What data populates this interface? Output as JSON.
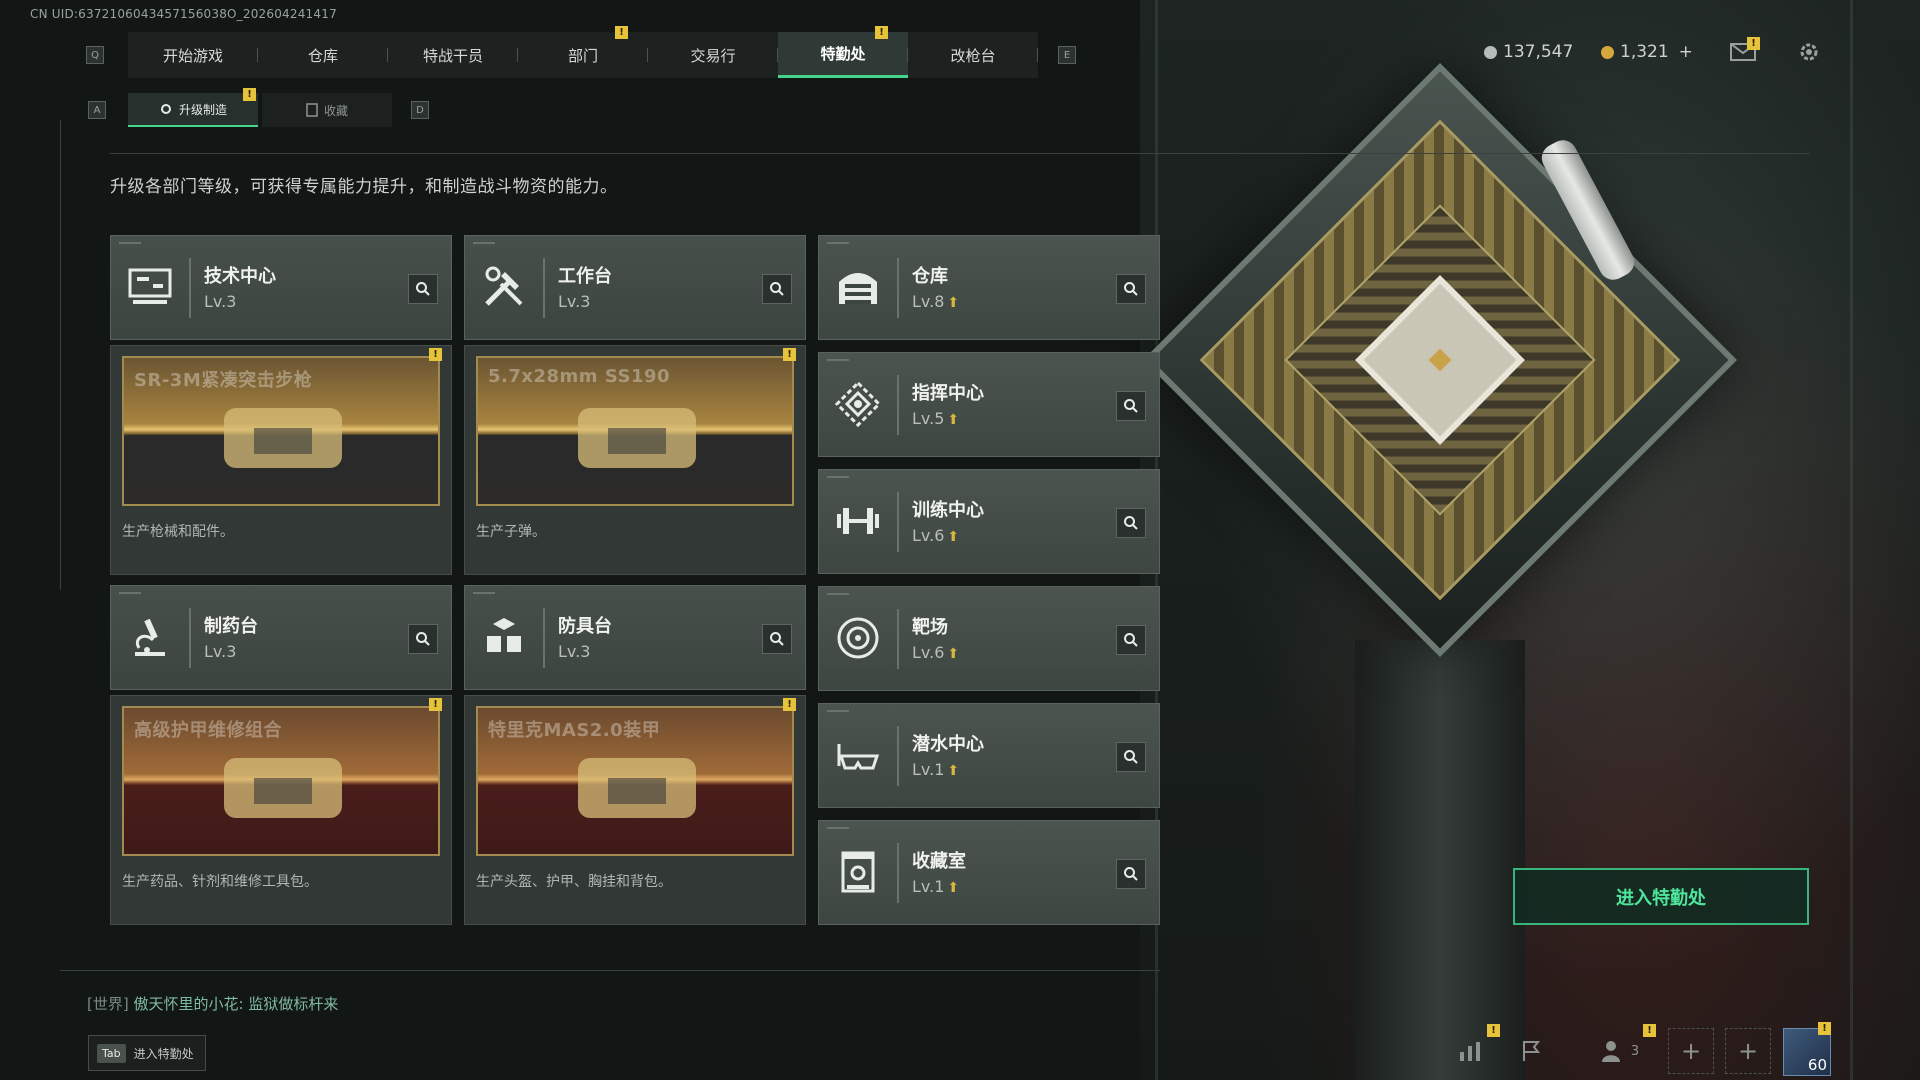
{
  "uid": "CN UID:6372106043457156038O_202604241417",
  "key_hints": {
    "left": "Q",
    "right": "E",
    "sub_left": "A",
    "sub_right": "D"
  },
  "nav": {
    "tabs": [
      {
        "label": "开始游戏",
        "active": false,
        "badge": false
      },
      {
        "label": "仓库",
        "active": false,
        "badge": false
      },
      {
        "label": "特战干员",
        "active": false,
        "badge": false
      },
      {
        "label": "部门",
        "active": false,
        "badge": true
      },
      {
        "label": "交易行",
        "active": false,
        "badge": false
      },
      {
        "label": "特勤处",
        "active": true,
        "badge": true
      },
      {
        "label": "改枪台",
        "active": false,
        "badge": false
      }
    ]
  },
  "currency": {
    "silver": {
      "value": "137,547",
      "color": "#b8bcb8"
    },
    "gold": {
      "value": "1,321",
      "color": "#d6a83c"
    },
    "add_symbol": "+"
  },
  "badge_symbol": "!",
  "subtabs": [
    {
      "label": "升级制造",
      "active": true,
      "badge": true
    },
    {
      "label": "收藏",
      "active": false,
      "badge": false
    }
  ],
  "description": "升级各部门等级，可获得专属能力提升，和制造战斗物资的能力。",
  "workshops": [
    {
      "name": "技术中心",
      "level": "Lv.3",
      "icon": "computer-icon",
      "upgradable": false,
      "product": {
        "name": "SR-3M紧凑突击步枪",
        "desc": "生产枪械和配件。",
        "theme": "gold",
        "badge": true
      }
    },
    {
      "name": "工作台",
      "level": "Lv.3",
      "icon": "tools-icon",
      "upgradable": false,
      "product": {
        "name": "5.7x28mm SS190",
        "desc": "生产子弹。",
        "theme": "gold",
        "badge": true
      }
    },
    {
      "name": "制药台",
      "level": "Lv.3",
      "icon": "microscope-icon",
      "upgradable": false,
      "product": {
        "name": "高级护甲维修组合",
        "desc": "生产药品、针剂和维修工具包。",
        "theme": "red",
        "badge": true
      }
    },
    {
      "name": "防具台",
      "level": "Lv.3",
      "icon": "armor-boxes-icon",
      "upgradable": false,
      "product": {
        "name": "特里克MAS2.0装甲",
        "desc": "生产头盔、护甲、胸挂和背包。",
        "theme": "red",
        "badge": true
      }
    }
  ],
  "departments": [
    {
      "name": "仓库",
      "level": "Lv.8",
      "icon": "warehouse-icon",
      "upgradable": true
    },
    {
      "name": "指挥中心",
      "level": "Lv.5",
      "icon": "command-icon",
      "upgradable": true
    },
    {
      "name": "训练中心",
      "level": "Lv.6",
      "icon": "dumbbell-icon",
      "upgradable": true
    },
    {
      "name": "靶场",
      "level": "Lv.6",
      "icon": "target-icon",
      "upgradable": true
    },
    {
      "name": "潜水中心",
      "level": "Lv.1",
      "icon": "goggles-icon",
      "upgradable": true
    },
    {
      "name": "收藏室",
      "level": "Lv.1",
      "icon": "collection-icon",
      "upgradable": true
    }
  ],
  "enter_button": "进入特勤处",
  "chat": {
    "channel": "[世界]",
    "message": "傲天怀里的小花: 监狱做标杆来"
  },
  "tab_hint": {
    "key": "Tab",
    "label": "进入特勤处"
  },
  "bottom_bar": {
    "party_count": "3",
    "slot_count": "60"
  },
  "accent": "#46d38e"
}
